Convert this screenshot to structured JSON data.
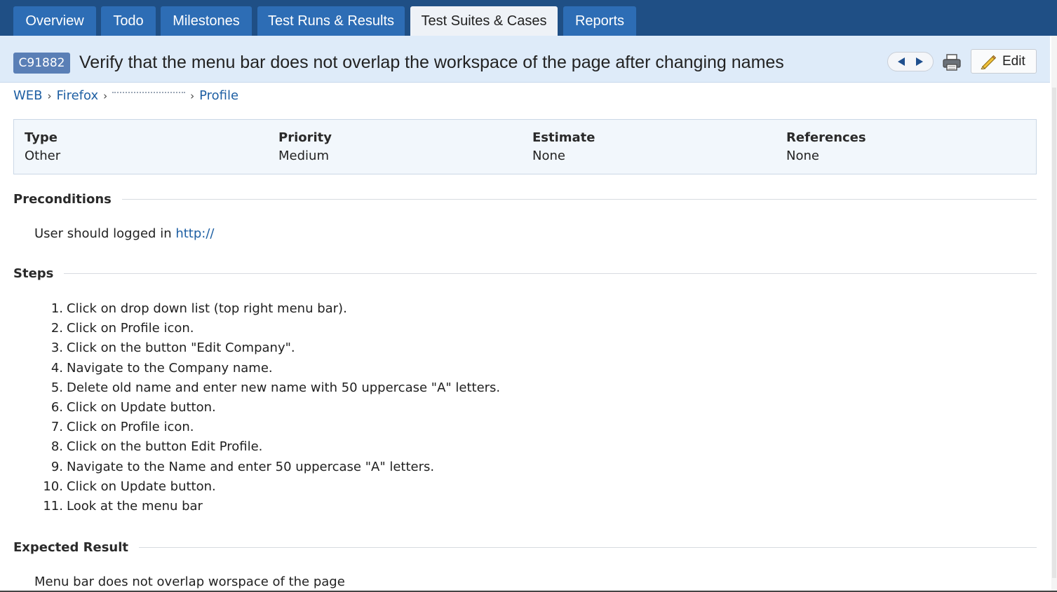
{
  "tabs": [
    {
      "label": "Overview",
      "active": false
    },
    {
      "label": "Todo",
      "active": false
    },
    {
      "label": "Milestones",
      "active": false
    },
    {
      "label": "Test Runs & Results",
      "active": false
    },
    {
      "label": "Test Suites & Cases",
      "active": true
    },
    {
      "label": "Reports",
      "active": false
    }
  ],
  "case": {
    "id": "C91882",
    "title": "Verify that the menu bar does not overlap the workspace of the page after changing names",
    "edit_label": "Edit"
  },
  "icons": {
    "prev": "chevron-left-icon",
    "next": "chevron-right-icon",
    "print": "printer-icon",
    "edit": "pencil-icon"
  },
  "breadcrumb": {
    "items": [
      "WEB",
      "Firefox",
      "Profile"
    ]
  },
  "fields": {
    "type": {
      "label": "Type",
      "value": "Other"
    },
    "priority": {
      "label": "Priority",
      "value": "Medium"
    },
    "estimate": {
      "label": "Estimate",
      "value": "None"
    },
    "references": {
      "label": "References",
      "value": "None"
    }
  },
  "preconditions": {
    "heading": "Preconditions",
    "text": "User should logged in",
    "link": "http://"
  },
  "steps": {
    "heading": "Steps",
    "items": [
      "Click on drop down list (top right menu bar).",
      "Click on Profile icon.",
      "Click on the button \"Edit Company\".",
      "Navigate to the Company name.",
      "Delete old name and enter new name with 50 uppercase \"A\" letters.",
      "Click on Update button.",
      "Click on Profile icon.",
      "Click on the button Edit Profile.",
      "Navigate to the Name and enter 50 uppercase \"A\" letters.",
      "Click on Update button.",
      "Look at the menu bar"
    ]
  },
  "expected": {
    "heading": "Expected Result",
    "text": "Menu bar does not overlap worspace of the page"
  },
  "colors": {
    "nav_bg": "#1f4f85",
    "tab_bg": "#2d6db5",
    "titlebar_bg": "#deebf9",
    "id_badge": "#5a7fb6",
    "link": "#1e5fa3"
  }
}
